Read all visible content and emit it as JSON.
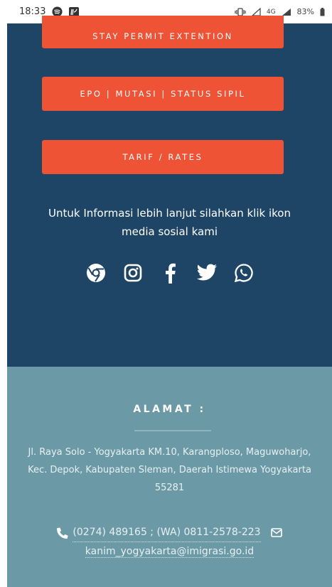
{
  "status_bar": {
    "time": "18:33",
    "network": "4G",
    "battery": "83%"
  },
  "buttons": {
    "stay_permit": "STAY PERMIT EXTENTION",
    "epo": "EPO | MUTASI | STATUS SIPIL",
    "tarif": "TARIF / RATES"
  },
  "info": {
    "text": "Untuk Informasi lebih lanjut silahkan klik ikon media sosial kami"
  },
  "social": {
    "icons": [
      "chrome-icon",
      "instagram-icon",
      "facebook-icon",
      "twitter-icon",
      "whatsapp-icon"
    ]
  },
  "footer": {
    "title": "ALAMAT :",
    "address": "Jl. Raya Solo - Yogyakarta KM.10, Karangploso, Maguwoharjo, Kec. Depok, Kabupaten Sleman, Daerah Istimewa Yogyakarta 55281",
    "phone": "(0274) 489165 ; (WA) 0811-2578-223",
    "email": "kanim_yogyakarta@imigrasi.go.id"
  },
  "colors": {
    "main_bg": "#1e4466",
    "button": "#ef5336",
    "footer_bg": "#6b9aa6"
  }
}
